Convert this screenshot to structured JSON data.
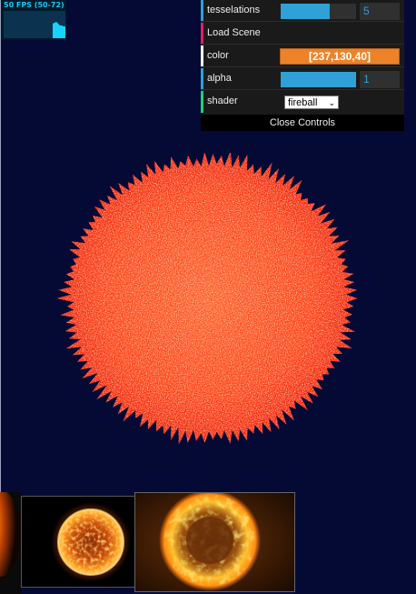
{
  "stats": {
    "fps_label": "50 FPS (50-72)"
  },
  "controls": {
    "tesselations": {
      "label": "tesselations",
      "value": "5",
      "fraction": 0.65
    },
    "load_scene": {
      "label": "Load Scene"
    },
    "color": {
      "label": "color",
      "value": "[237,130,40]",
      "hex": "#ed8228"
    },
    "alpha": {
      "label": "alpha",
      "value": "1",
      "fraction": 1.0
    },
    "shader": {
      "label": "shader",
      "selected": "fireball"
    },
    "close_label": "Close Controls"
  },
  "colors": {
    "background": "#050a35",
    "panel": "#1a1a1a",
    "slider_fill": "#2fa1d6",
    "stat_text": "#19c6ff",
    "stripe_number": "#2fa1d6",
    "stripe_function": "#e61d5f",
    "stripe_color": "#ffffff",
    "stripe_option": "#1ed36f"
  },
  "icons": {
    "shader_dropdown": "chevron-down-icon"
  },
  "thumbnails": [
    {
      "name": "fire-thumbnail-partial"
    },
    {
      "name": "sun-thumbnail"
    },
    {
      "name": "fireball-ring-thumbnail"
    }
  ]
}
